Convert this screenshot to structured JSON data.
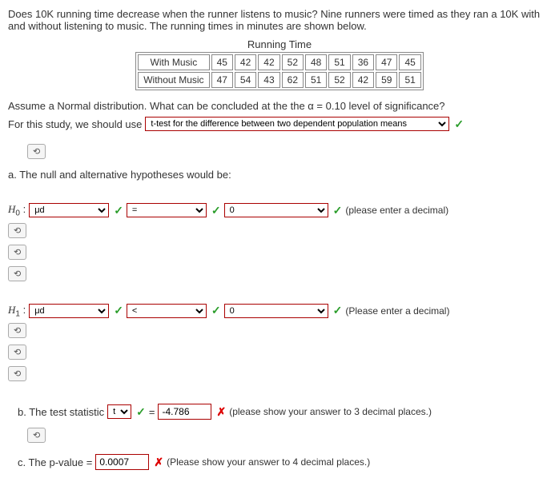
{
  "intro1": "Does 10K running time decrease when the runner listens to music? Nine runners were timed as they ran a 10K with and without listening to music. The running times in minutes are shown below.",
  "table": {
    "title": "Running Time",
    "row1_label": "With Music",
    "row1": [
      "45",
      "42",
      "42",
      "52",
      "48",
      "51",
      "36",
      "47",
      "45"
    ],
    "row2_label": "Without Music",
    "row2": [
      "47",
      "54",
      "43",
      "62",
      "51",
      "52",
      "42",
      "59",
      "51"
    ]
  },
  "assume": "Assume a Normal distribution.  What can be concluded at the the α = 0.10 level of significance?",
  "study_lead": "For this study, we should use",
  "study_select": "t-test for the difference between two dependent population means",
  "retry_icon": "⟲",
  "part_a": "a. The null and alternative hypotheses would be:",
  "h0_label": "H",
  "h0_sub": "0",
  "h1_label": "H",
  "h1_sub": "1",
  "colon": " :",
  "mu_d": "μd",
  "eq_op": "=",
  "lt_op": "<",
  "zero": "0",
  "empty": "",
  "h0_hint": "(please enter a decimal)",
  "h1_hint": "(Please enter a decimal)",
  "part_b_lead": "b. The test statistic",
  "stat_sym": "t",
  "equals": " = ",
  "stat_val": "-4.786",
  "stat_hint": "(please show your answer to 3 decimal places.)",
  "part_c_lead": "c. The p-value = ",
  "pval": "0.0007",
  "pval_hint": "(Please show your answer to 4 decimal places.)",
  "check": "✓",
  "cross": "✗"
}
